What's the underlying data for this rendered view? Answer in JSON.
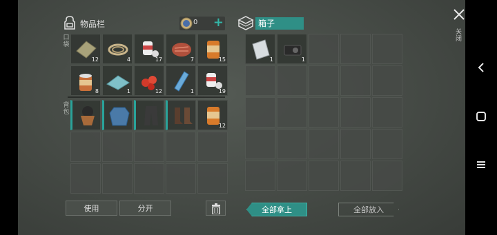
{
  "inventory": {
    "title": "物品栏",
    "coin_value": "0",
    "plus_label": "+",
    "pocket_label": "口袋",
    "backpack_label": "背包",
    "pocket_items": [
      {
        "icon": "cloth-bundle-icon",
        "count": "12"
      },
      {
        "icon": "rope-icon",
        "count": "4"
      },
      {
        "icon": "bandage-icon",
        "count": "17"
      },
      {
        "icon": "meat-icon",
        "count": "7"
      },
      {
        "icon": "canned-food-icon",
        "count": "15"
      },
      {
        "icon": "open-can-icon",
        "count": "8"
      },
      {
        "icon": "tarp-icon",
        "count": "1"
      },
      {
        "icon": "berries-icon",
        "count": "12"
      },
      {
        "icon": "water-bottle-icon",
        "count": "1"
      },
      {
        "icon": "bandage-icon",
        "count": "19"
      }
    ],
    "backpack_items": [
      {
        "icon": "balaclava-icon",
        "count": ""
      },
      {
        "icon": "jacket-icon",
        "count": ""
      },
      {
        "icon": "pants-icon",
        "count": ""
      },
      {
        "icon": "boots-icon",
        "count": ""
      },
      {
        "icon": "canned-food-icon",
        "count": "12"
      }
    ]
  },
  "box": {
    "title": "箱子",
    "items": [
      {
        "icon": "metal-sheet-icon",
        "count": "1"
      },
      {
        "icon": "camera-icon",
        "count": "1"
      }
    ]
  },
  "buttons": {
    "use": "使用",
    "split": "分开",
    "take_all": "全部拿上",
    "put_all": "全部放入",
    "close": "关闭"
  },
  "colors": {
    "accent": "#2f8f86",
    "plus": "#33b7a8"
  }
}
